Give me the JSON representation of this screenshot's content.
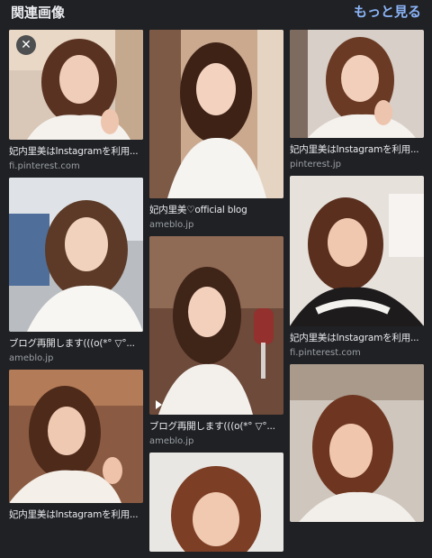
{
  "header": {
    "title": "関連画像",
    "more_label": "もっと見る"
  },
  "icons": {
    "close": "close-icon",
    "play": "play-icon"
  },
  "cards": [
    {
      "caption": "妃内里美はInstagramを利用...",
      "source": "fi.pinterest.com"
    },
    {
      "caption": "ブログ再開します(((o(*° ▽°...",
      "source": "ameblo.jp"
    },
    {
      "caption": "妃内里美はInstagramを利用...",
      "source": ""
    },
    {
      "caption": "妃内里美♡official blog",
      "source": "ameblo.jp"
    },
    {
      "caption": "ブログ再開します(((o(*° ▽°...",
      "source": "ameblo.jp"
    },
    {
      "caption": "",
      "source": ""
    },
    {
      "caption": "妃内里美はInstagramを利用...",
      "source": "pinterest.jp"
    },
    {
      "caption": "妃内里美はInstagramを利用...",
      "source": "fi.pinterest.com"
    },
    {
      "caption": "",
      "source": ""
    }
  ],
  "colors": {
    "background": "#202124",
    "link": "#8ab4f8",
    "text": "#e8eaed",
    "muted": "#9aa0a6"
  }
}
